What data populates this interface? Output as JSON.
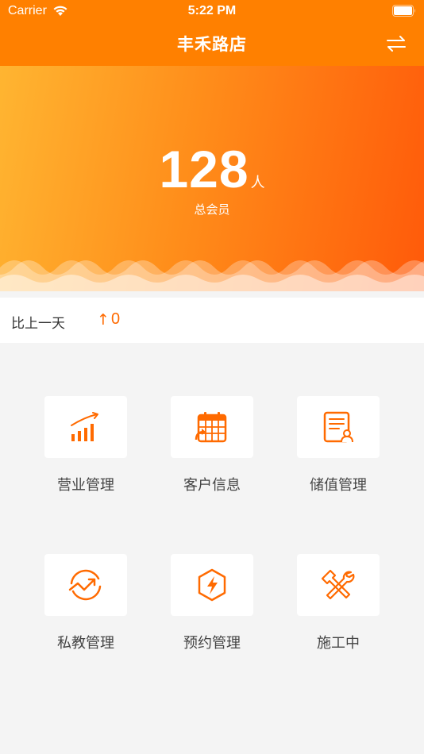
{
  "status_bar": {
    "carrier": "Carrier",
    "time": "5:22 PM"
  },
  "header": {
    "title": "丰禾路店",
    "switch_icon": "switch-arrows-icon"
  },
  "hero": {
    "count": "128",
    "unit": "人",
    "label": "总会员"
  },
  "compare": {
    "label": "比上一天",
    "arrow": "↑",
    "value": "0"
  },
  "menu": [
    {
      "label": "营业管理",
      "icon": "business-chart-icon"
    },
    {
      "label": "客户信息",
      "icon": "calendar-icon"
    },
    {
      "label": "储值管理",
      "icon": "document-user-icon"
    },
    {
      "label": "私教管理",
      "icon": "trend-circle-icon"
    },
    {
      "label": "预约管理",
      "icon": "lightning-hexagon-icon"
    },
    {
      "label": "施工中",
      "icon": "tools-icon"
    }
  ],
  "colors": {
    "brand": "#ff8000",
    "accent": "#ff6a00",
    "hero_start": "#ffb531",
    "hero_end": "#ff5a0a"
  }
}
